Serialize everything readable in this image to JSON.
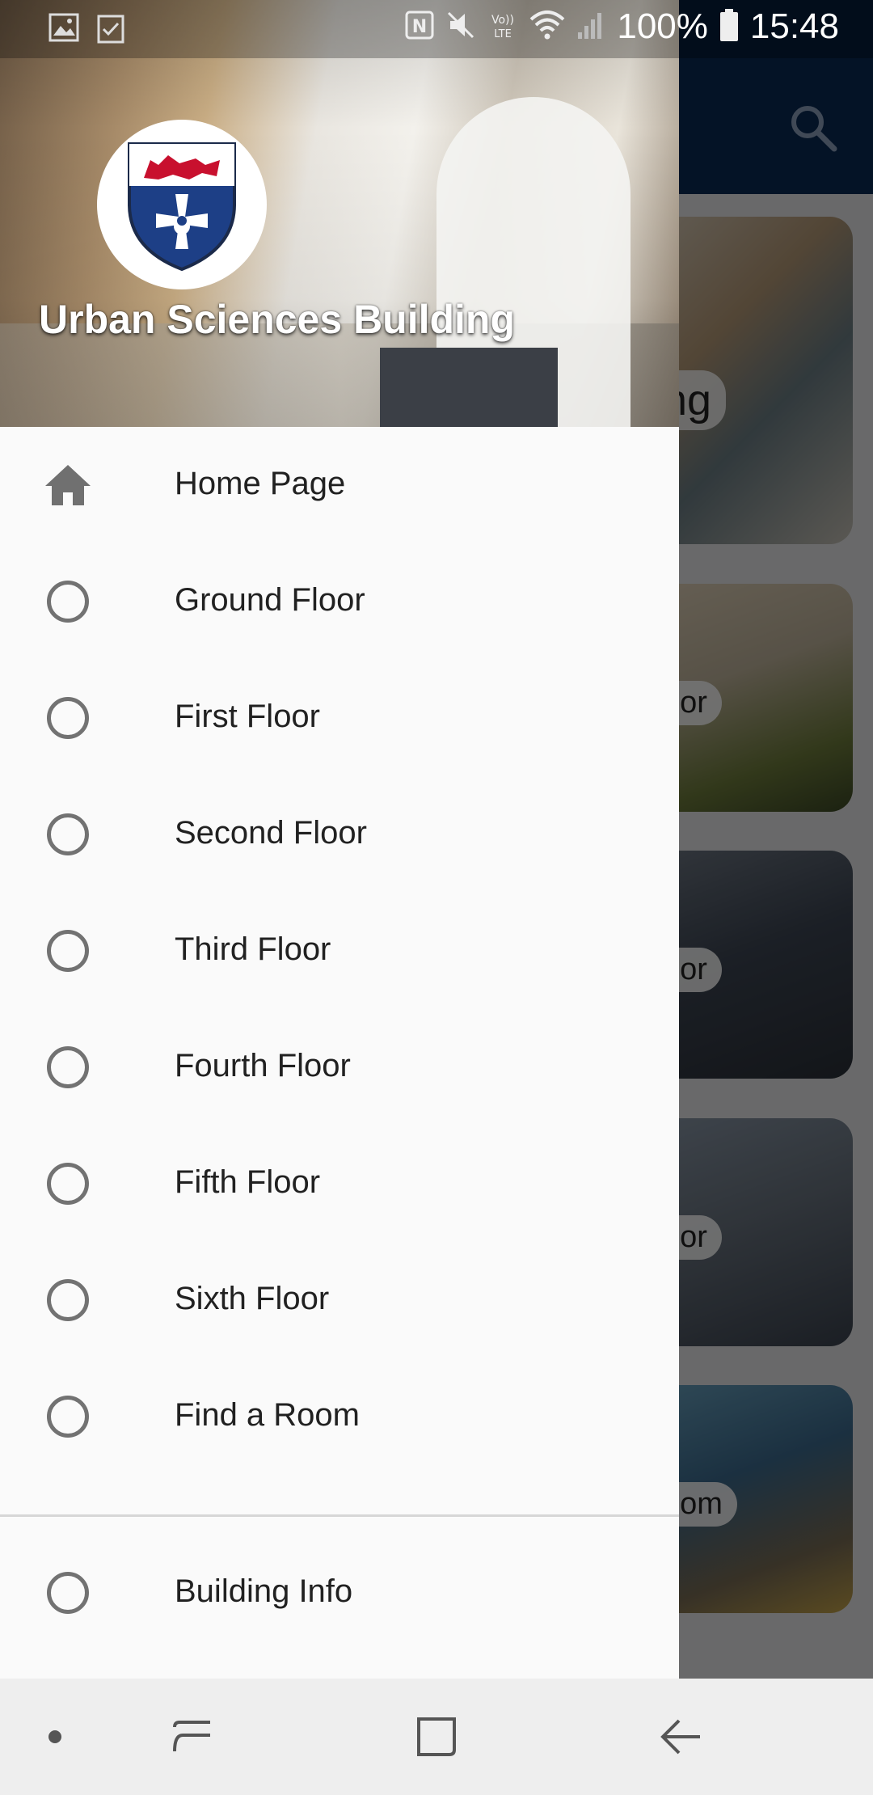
{
  "status_bar": {
    "battery": "100%",
    "time": "15:48",
    "icons": [
      "gallery-icon",
      "checklist-icon",
      "nfc-icon",
      "mute-icon",
      "volte-icon",
      "wifi-icon",
      "signal-icon",
      "battery-icon"
    ]
  },
  "background_app": {
    "title_fragment": "ng",
    "cards": [
      {
        "label_fragment": "oor"
      },
      {
        "label_fragment": "oor"
      },
      {
        "label_fragment": "oor"
      },
      {
        "label_fragment": "oom"
      }
    ]
  },
  "drawer": {
    "header_title": "Urban Sciences Building",
    "items": [
      {
        "label": "Home Page",
        "icon": "home-icon"
      },
      {
        "label": "Ground Floor",
        "icon": "circle-icon"
      },
      {
        "label": "First Floor",
        "icon": "circle-icon"
      },
      {
        "label": "Second Floor",
        "icon": "circle-icon"
      },
      {
        "label": "Third Floor",
        "icon": "circle-icon"
      },
      {
        "label": "Fourth Floor",
        "icon": "circle-icon"
      },
      {
        "label": "Fifth Floor",
        "icon": "circle-icon"
      },
      {
        "label": "Sixth Floor",
        "icon": "circle-icon"
      },
      {
        "label": "Find a Room",
        "icon": "circle-icon"
      }
    ],
    "secondary_items": [
      {
        "label": "Building Info",
        "icon": "circle-icon"
      }
    ]
  },
  "colors": {
    "appbar": "#0b2a55",
    "drawer_bg": "#fafafa",
    "icon_grey": "#727272",
    "text": "#212121"
  }
}
